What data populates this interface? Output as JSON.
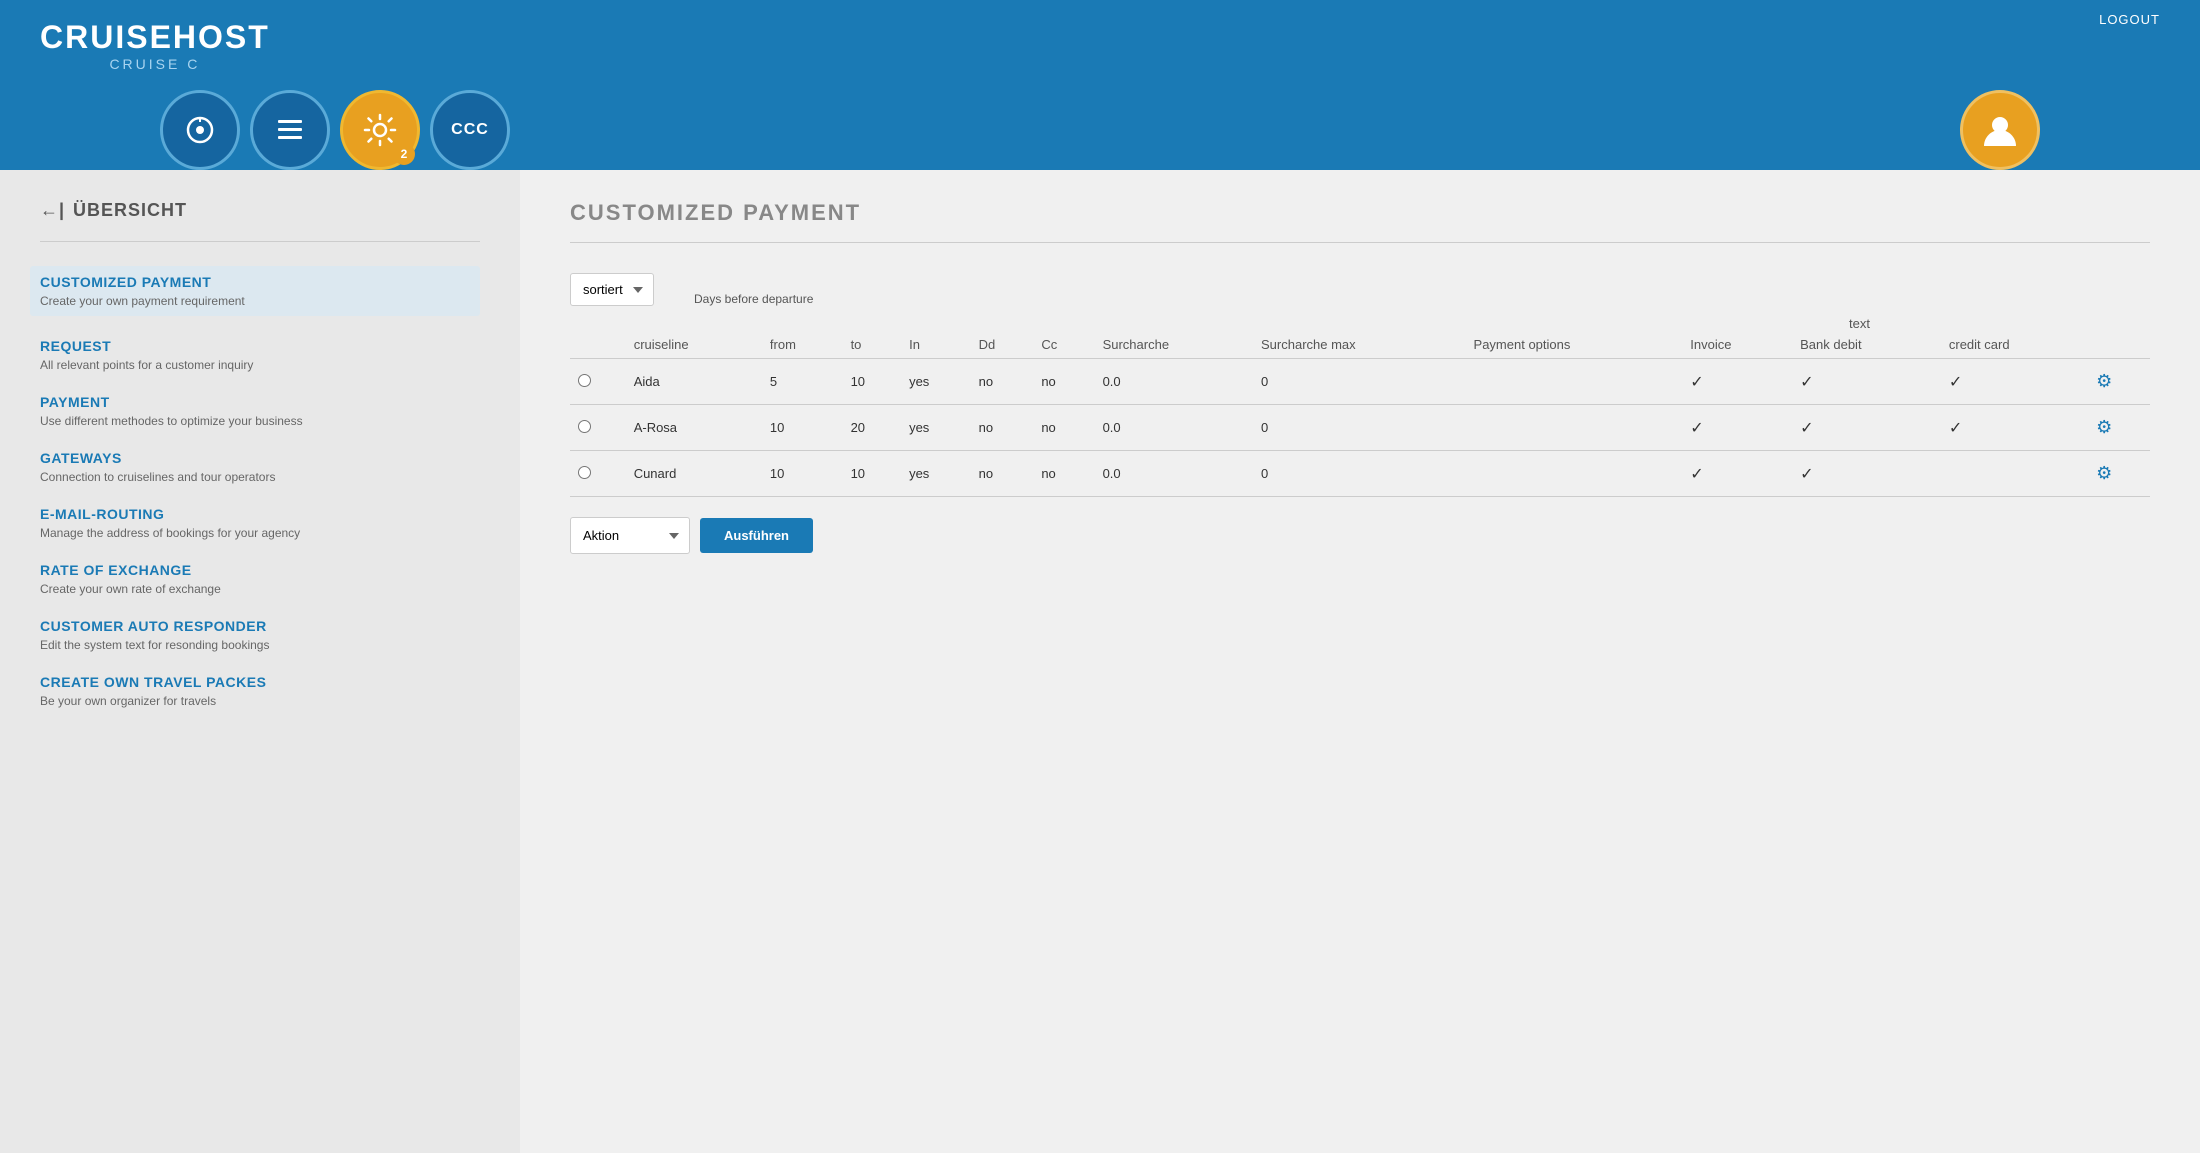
{
  "header": {
    "logo_main": "CRUISEHOST",
    "logo_sub": "CRUISE C",
    "logout_label": "LOGOUT"
  },
  "nav": {
    "icons": [
      {
        "name": "dashboard-icon",
        "symbol": "◎",
        "active": false,
        "badge": null
      },
      {
        "name": "list-icon",
        "symbol": "▤",
        "active": false,
        "badge": null
      },
      {
        "name": "gear-nav-icon",
        "symbol": "⚙",
        "active": true,
        "badge": "2"
      },
      {
        "name": "ccc-icon",
        "symbol": "CCC",
        "active": false,
        "badge": null
      }
    ],
    "user_icon": "👤"
  },
  "sidebar": {
    "back_label": "ÜBERSICHT",
    "items": [
      {
        "id": "customized-payment",
        "title": "CUSTOMIZED PAYMENT",
        "desc": "Create your own payment requirement",
        "active": true
      },
      {
        "id": "request",
        "title": "REQUEST",
        "desc": "All relevant points for a customer inquiry",
        "active": false
      },
      {
        "id": "payment",
        "title": "PAYMENT",
        "desc": "Use different methodes to optimize your business",
        "active": false
      },
      {
        "id": "gateways",
        "title": "GATEWAYS",
        "desc": "Connection to cruiselines and tour operators",
        "active": false
      },
      {
        "id": "email-routing",
        "title": "E-MAIL-ROUTING",
        "desc": "Manage the address of bookings for your agency",
        "active": false
      },
      {
        "id": "rate-of-exchange",
        "title": "RATE OF EXCHANGE",
        "desc": "Create your own rate of exchange",
        "active": false
      },
      {
        "id": "customer-auto-responder",
        "title": "CUSTOMER AUTO RESPONDER",
        "desc": "Edit the system text for resonding bookings",
        "active": false
      },
      {
        "id": "create-own-travel-packes",
        "title": "CREATE OWN TRAVEL PACKES",
        "desc": "Be your own organizer for travels",
        "active": false
      }
    ]
  },
  "main": {
    "page_title": "CUSTOMIZED PAYMENT",
    "sort_label": "sortiert",
    "text_label": "text",
    "table": {
      "columns": {
        "cruiseline": "cruiseline",
        "from": "from",
        "to": "to",
        "in": "In",
        "dd": "Dd",
        "cc": "Cc",
        "surcharge": "Surcharche",
        "surcharge_max": "Surcharche max",
        "payment_options": "Payment options",
        "invoice": "Invoice",
        "bank_debit": "Bank debit",
        "credit_card": "credit card",
        "days_before_departure": "Days before departure"
      },
      "rows": [
        {
          "cruiseline": "Aida",
          "from": "5",
          "to": "10",
          "in": "yes",
          "dd": "no",
          "cc": "no",
          "surcharge": "0.0",
          "surcharge_max": "0",
          "payment_options": "",
          "invoice": true,
          "bank_debit": true,
          "credit_card": true
        },
        {
          "cruiseline": "A-Rosa",
          "from": "10",
          "to": "20",
          "in": "yes",
          "dd": "no",
          "cc": "no",
          "surcharge": "0.0",
          "surcharge_max": "0",
          "payment_options": "",
          "invoice": true,
          "bank_debit": true,
          "credit_card": true
        },
        {
          "cruiseline": "Cunard",
          "from": "10",
          "to": "10",
          "in": "yes",
          "dd": "no",
          "cc": "no",
          "surcharge": "0.0",
          "surcharge_max": "0",
          "payment_options": "",
          "invoice": true,
          "bank_debit": true,
          "credit_card": false
        }
      ]
    },
    "action_label": "Aktion",
    "execute_label": "Ausführen",
    "sort_options": [
      "sortiert"
    ],
    "action_options": [
      "Aktion"
    ]
  }
}
